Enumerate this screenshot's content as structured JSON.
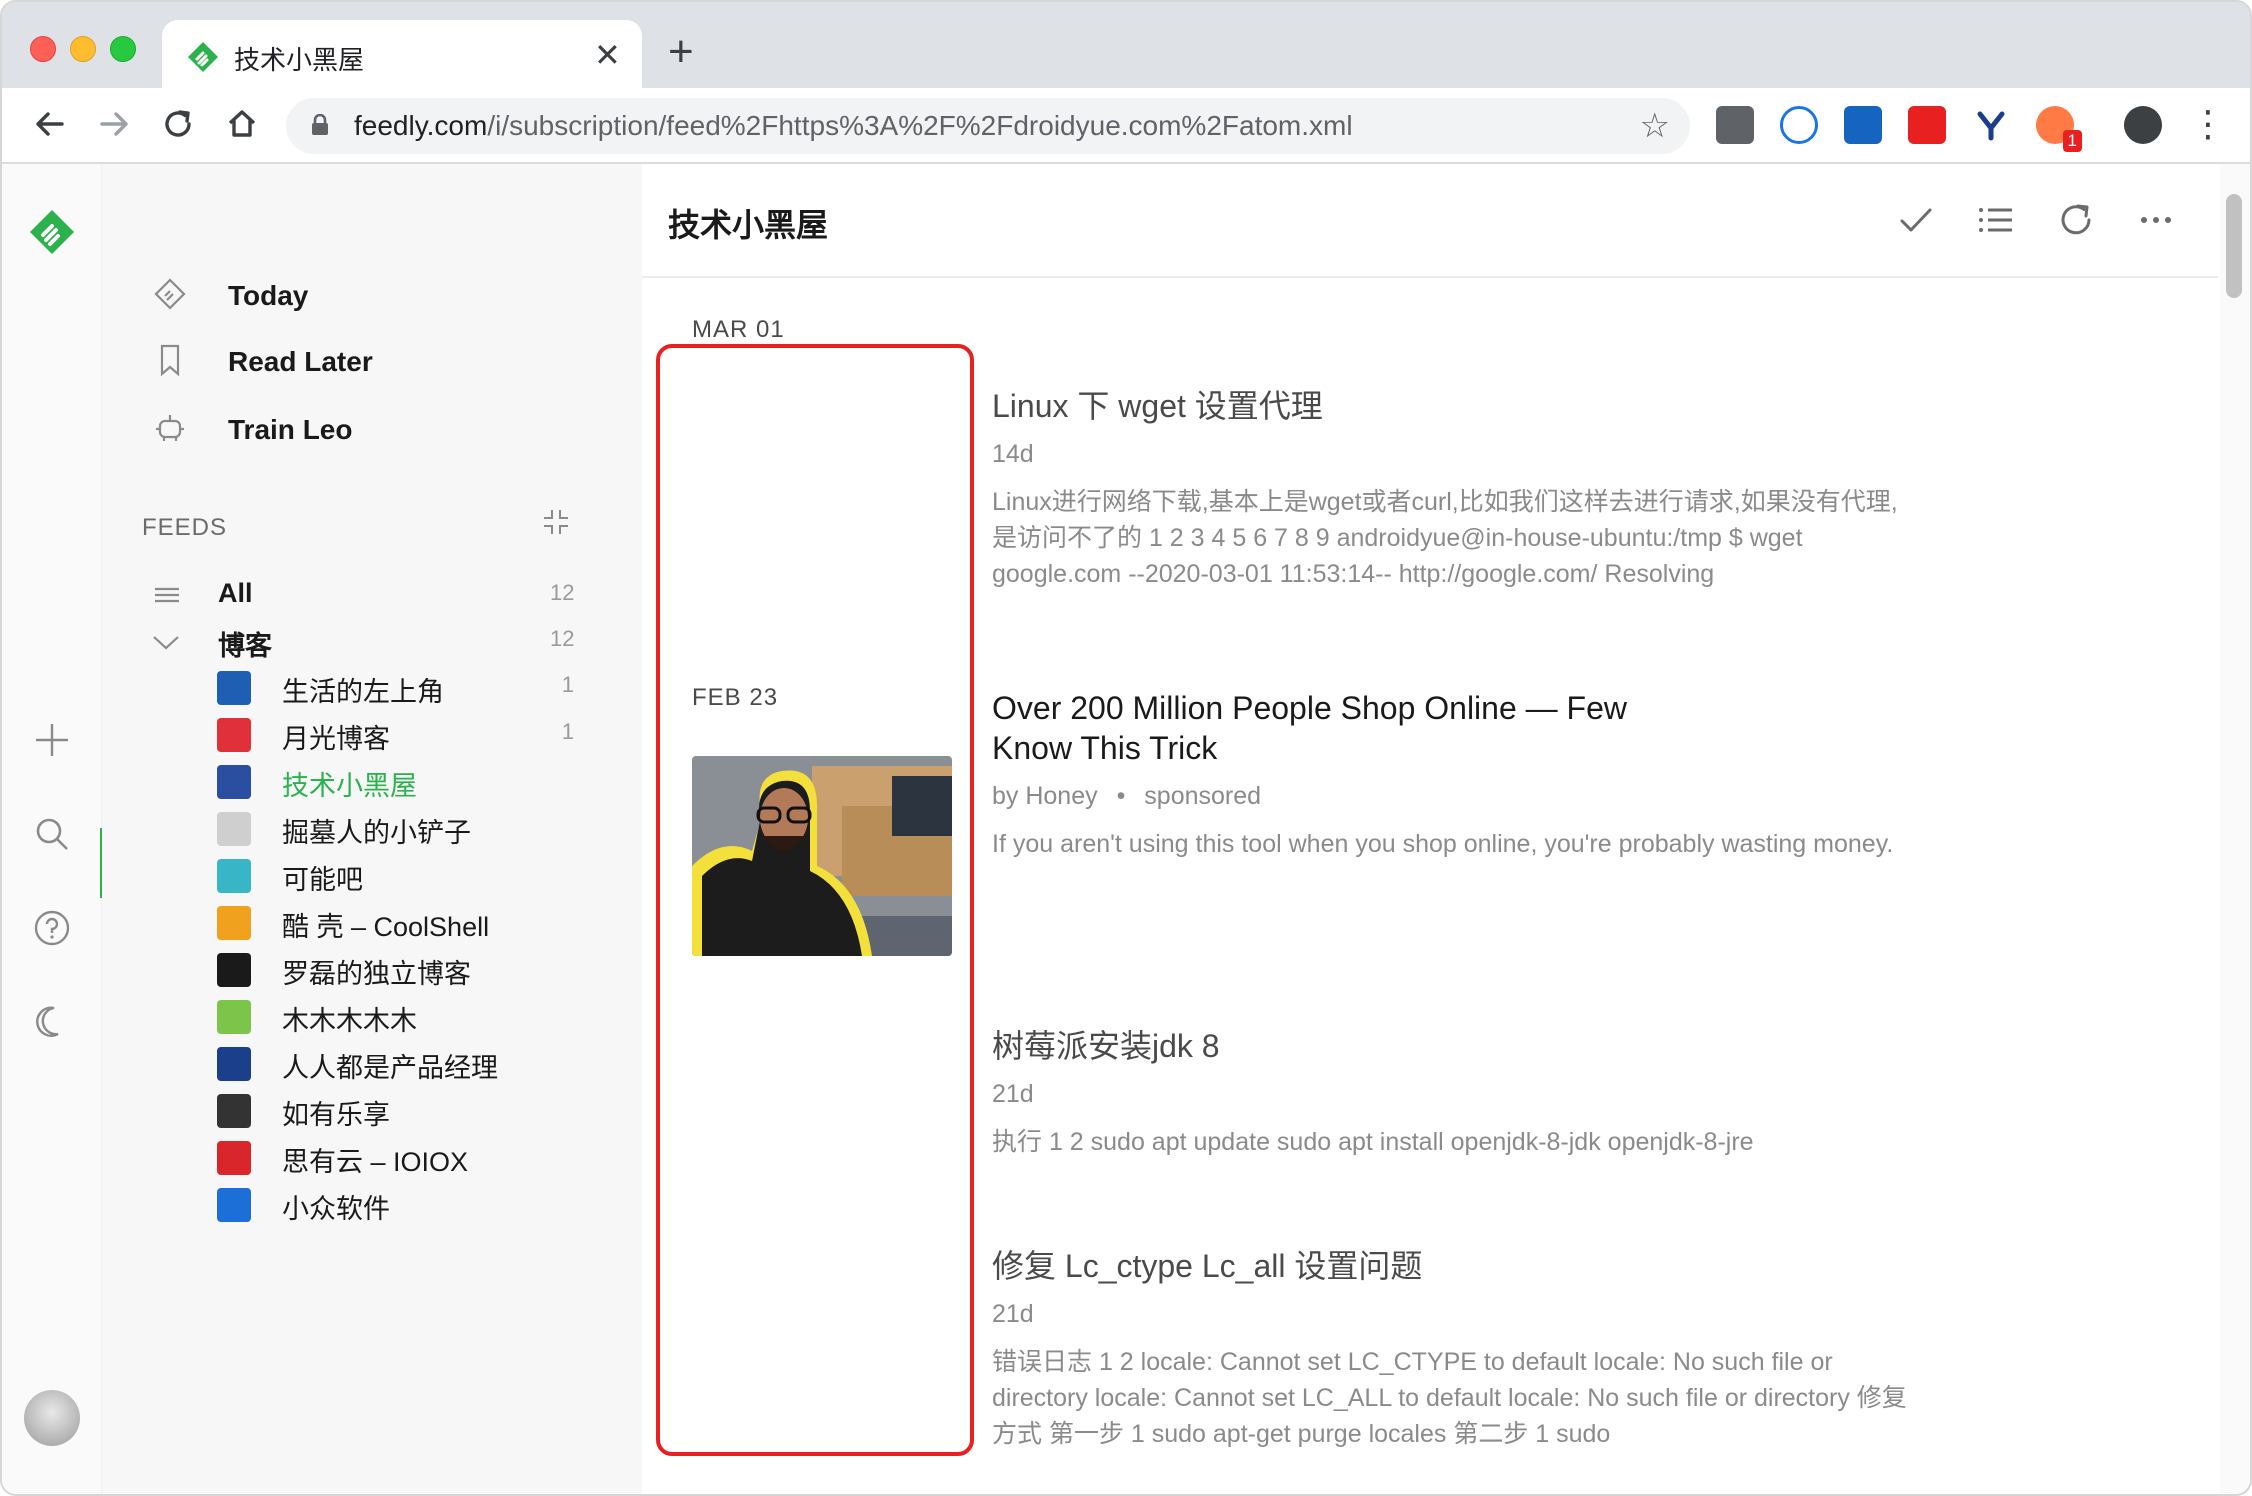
{
  "browser": {
    "tab_title": "技术小黑屋",
    "tab_close": "✕",
    "new_tab": "+",
    "url_host": "feedly.com",
    "url_path": "/i/subscription/feed%2Fhttps%3A%2F%2Fdroidyue.com%2Fatom.xml",
    "ext_badge": "1"
  },
  "colors": {
    "accent": "#2bb24c",
    "highlight_box": "#e8201f"
  },
  "nav": {
    "today": "Today",
    "read_later": "Read Later",
    "train": "Train Leo"
  },
  "feeds": {
    "header": "FEEDS",
    "all_label": "All",
    "all_count": "12",
    "group_label": "博客",
    "group_count": "12",
    "items": [
      {
        "name": "生活的左上角",
        "count": "1",
        "icon_color": "#1e5fb4"
      },
      {
        "name": "月光博客",
        "count": "1",
        "icon_color": "#e0303a"
      },
      {
        "name": "技术小黑屋",
        "count": "",
        "icon_color": "#2a4fa0"
      },
      {
        "name": "掘墓人的小铲子",
        "count": "",
        "icon_color": "#cfcfcf"
      },
      {
        "name": "可能吧",
        "count": "",
        "icon_color": "#38b6c8"
      },
      {
        "name": "酷 壳 – CoolShell",
        "count": "",
        "icon_color": "#f0a21f"
      },
      {
        "name": "罗磊的独立博客",
        "count": "",
        "icon_color": "#1a1a1a"
      },
      {
        "name": "木木木木木",
        "count": "",
        "icon_color": "#7cc54a"
      },
      {
        "name": "人人都是产品经理",
        "count": "",
        "icon_color": "#1c3f8c"
      },
      {
        "name": "如有乐享",
        "count": "",
        "icon_color": "#333333"
      },
      {
        "name": "思有云 – IOIOX",
        "count": "",
        "icon_color": "#d8262b"
      },
      {
        "name": "小众软件",
        "count": "",
        "icon_color": "#1d6fd8"
      }
    ]
  },
  "main": {
    "title": "技术小黑屋",
    "dates": [
      "MAR 01",
      "FEB 23"
    ],
    "articles": [
      {
        "title": "Linux 下 wget 设置代理",
        "meta": "14d",
        "summary": "Linux进行网络下载,基本上是wget或者curl,比如我们这样去进行请求,如果没有代理,是访问不了的 1 2 3 4 5 6 7 8 9 androidyue@in-house-ubuntu:/tmp $ wget google.com --2020-03-01 11:53:14-- http://google.com/ Resolving"
      },
      {
        "title": "Over 200 Million People Shop Online — Few Know This Trick",
        "meta_author": "by Honey",
        "meta_sep": "•",
        "meta_tag": "sponsored",
        "summary": "If you aren't using this tool when you shop online, you're probably wasting money."
      },
      {
        "title": "树莓派安装jdk 8",
        "meta": "21d",
        "summary": "执行 1 2 sudo apt update sudo apt install openjdk-8-jdk openjdk-8-jre"
      },
      {
        "title": "修复 Lc_ctype Lc_all 设置问题",
        "meta": "21d",
        "summary": "错误日志 1 2 locale: Cannot set LC_CTYPE to default locale: No such file or directory locale: Cannot set LC_ALL to default locale: No such file or directory 修复方式 第一步 1 sudo apt-get purge locales 第二步 1 sudo"
      }
    ]
  }
}
